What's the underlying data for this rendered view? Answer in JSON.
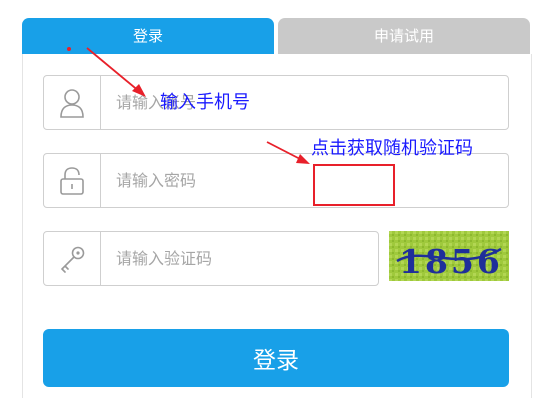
{
  "tabs": {
    "login_label": "登录",
    "trial_label": "申请试用"
  },
  "form": {
    "account_placeholder": "请输入账号",
    "password_placeholder": "请输入密码",
    "code_placeholder": "请输入验证码",
    "captcha_text": "1856",
    "submit_label": "登录"
  },
  "icons": {
    "account": "user-icon",
    "password": "lock-icon",
    "code": "key-icon"
  },
  "annotations": {
    "phone_note": "输入手机号",
    "captcha_note": "点击获取随机验证码"
  },
  "colors": {
    "accent": "#18a0e8",
    "tab_inactive": "#c9c9c9",
    "annotation_text": "#1a1aff",
    "annotation_mark": "#e8202a"
  }
}
